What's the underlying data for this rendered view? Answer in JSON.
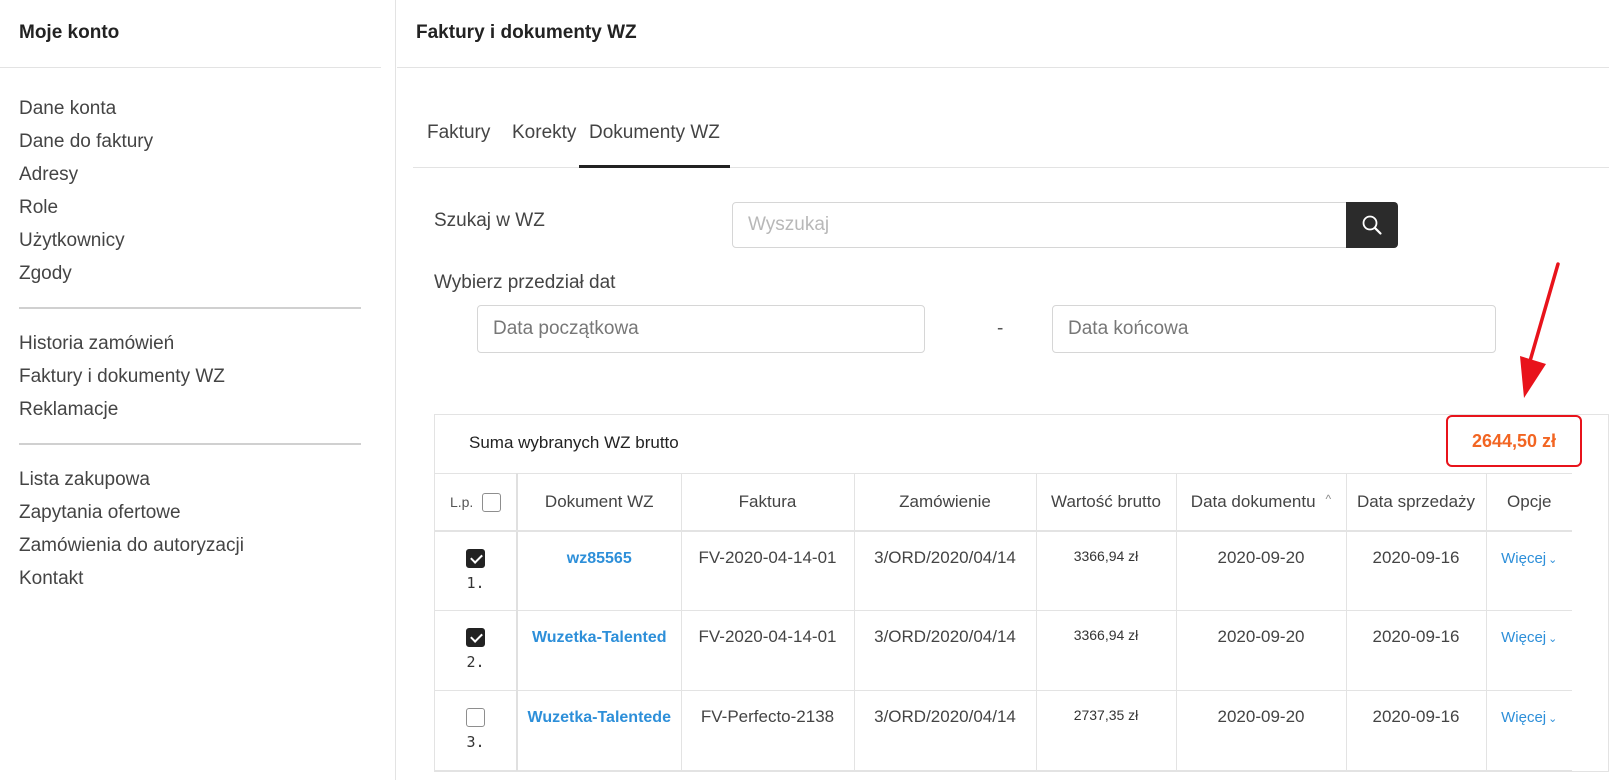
{
  "sidebar": {
    "title": "Moje konto",
    "groups": [
      [
        "Dane konta",
        "Dane do faktury",
        "Adresy",
        "Role",
        "Użytkownicy",
        "Zgody"
      ],
      [
        "Historia zamówień",
        "Faktury i dokumenty WZ",
        "Reklamacje"
      ],
      [
        "Lista zakupowa",
        "Zapytania ofertowe",
        "Zamówienia do autoryzacji",
        "Kontakt"
      ]
    ]
  },
  "main": {
    "title": "Faktury i dokumenty WZ",
    "tabs": [
      "Faktury",
      "Korekty",
      "Dokumenty WZ"
    ],
    "active_tab": "Dokumenty WZ",
    "search": {
      "label": "Szukaj w WZ",
      "placeholder": "Wyszukaj",
      "icon": "search-icon"
    },
    "dates": {
      "label": "Wybierz przedział dat",
      "start_placeholder": "Data początkowa",
      "end_placeholder": "Data końcowa",
      "separator": "-"
    },
    "summary": {
      "label": "Suma wybranych WZ brutto",
      "value": "2644,50 zł"
    },
    "table": {
      "headers": [
        "L.p.",
        "Dokument WZ",
        "Faktura",
        "Zamówienie",
        "Wartość brutto",
        "Data dokumentu",
        "Data sprzedaży",
        "Opcje"
      ],
      "rows": [
        {
          "lp": "1.",
          "checked": true,
          "doc": "wz85565",
          "invoice": "FV-2020-04-14-01",
          "order": "3/ORD/2020/04/14",
          "value": "3366,94 zł",
          "doc_date": "2020-09-20",
          "sale_date": "2020-09-16",
          "options": "Więcej"
        },
        {
          "lp": "2.",
          "checked": true,
          "doc": "Wuzetka-Talented",
          "invoice": "FV-2020-04-14-01",
          "order": "3/ORD/2020/04/14",
          "value": "3366,94 zł",
          "doc_date": "2020-09-20",
          "sale_date": "2020-09-16",
          "options": "Więcej"
        },
        {
          "lp": "3.",
          "checked": false,
          "doc": "Wuzetka-Talentede",
          "invoice": "FV-Perfecto-2138",
          "order": "3/ORD/2020/04/14",
          "value": "2737,35 zł",
          "doc_date": "2020-09-20",
          "sale_date": "2020-09-16",
          "options": "Więcej"
        }
      ]
    }
  },
  "colors": {
    "accent": "#2d8fd9",
    "highlight_border": "#e8131b",
    "highlight_text": "#f26522"
  }
}
